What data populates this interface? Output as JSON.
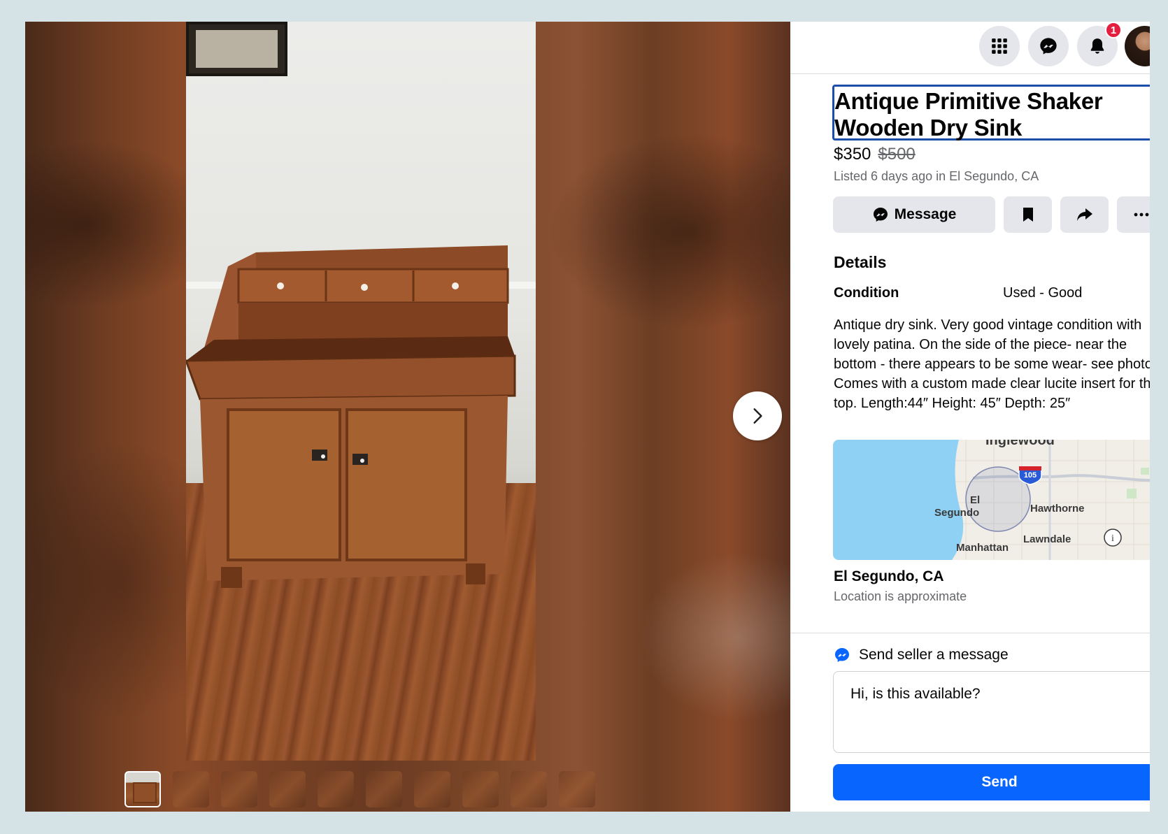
{
  "listing": {
    "title": "Antique Primitive Shaker Wooden Dry Sink",
    "price": "$350",
    "original_price": "$500",
    "listed": "Listed 6 days ago in El Segundo, CA"
  },
  "actions": {
    "message_label": "Message"
  },
  "topbar": {
    "notification_count": "1"
  },
  "details": {
    "heading": "Details",
    "condition_label": "Condition",
    "condition_value": "Used - Good",
    "description": "Antique dry sink. Very good vintage condition with lovely patina. On the side of the piece- near the bottom - there appears to be some wear- see photo. Comes with a custom made clear lucite insert for the top. Length:44″ Height: 45″ Depth: 25″"
  },
  "map": {
    "labels": {
      "inglewood": "Inglewood",
      "el": "El",
      "segundo": "Segundo",
      "hawthorne": "Hawthorne",
      "lawndale": "Lawndale",
      "manhattan": "Manhattan",
      "highway": "105"
    }
  },
  "location": {
    "name": "El Segundo, CA",
    "note": "Location is approximate"
  },
  "message_box": {
    "label": "Send seller a message",
    "value": "Hi, is this available?",
    "send_label": "Send"
  },
  "gallery": {
    "thumbnail_count": 10,
    "active_index": 0
  },
  "colors": {
    "accent": "#0866ff",
    "badge": "#e41e3f",
    "title_focus": "#1b4ea8"
  }
}
